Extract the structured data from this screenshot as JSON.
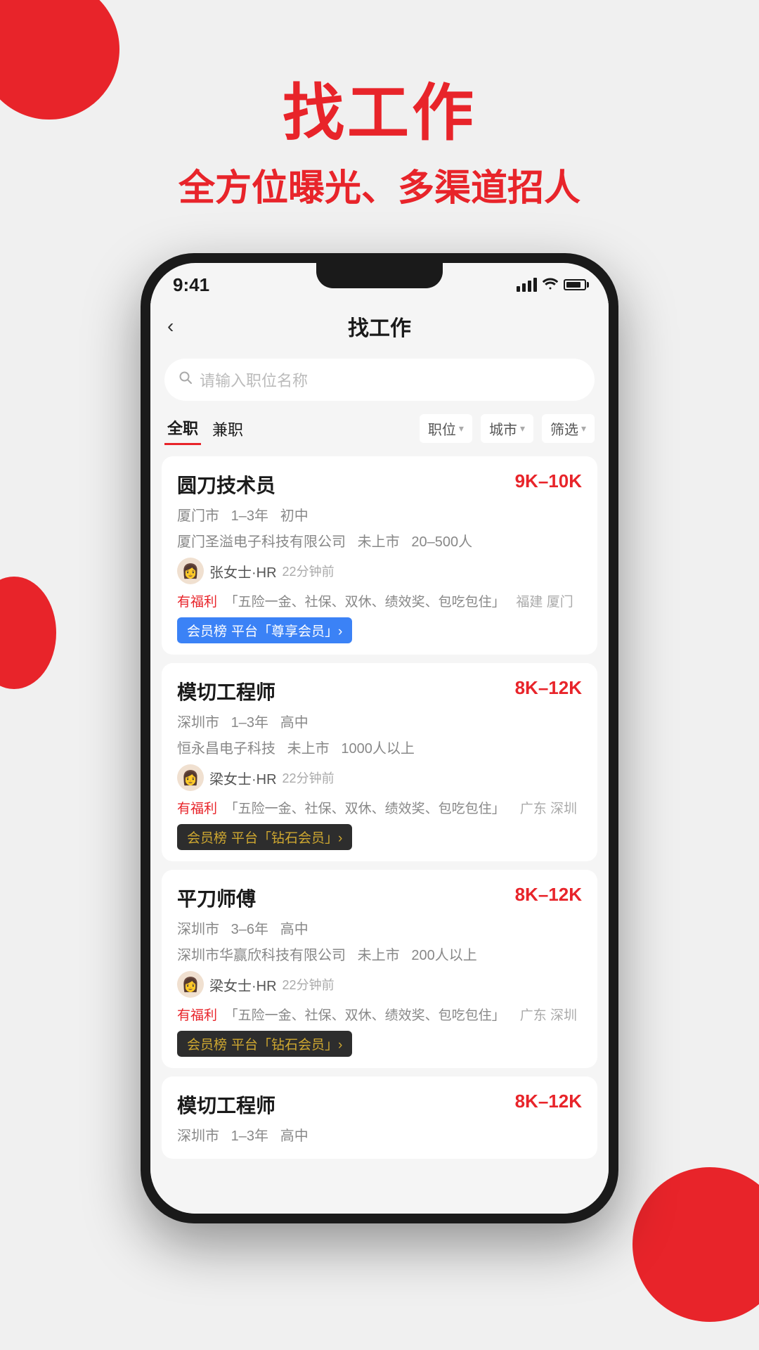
{
  "app": {
    "header_title": "找工作",
    "header_subtitle": "全方位曝光、多渠道招人"
  },
  "status_bar": {
    "time": "9:41"
  },
  "nav": {
    "back": "‹",
    "title": "找工作"
  },
  "search": {
    "placeholder": "请输入职位名称"
  },
  "tabs": [
    {
      "label": "全职",
      "active": true
    },
    {
      "label": "兼职",
      "active": false
    }
  ],
  "filters": [
    {
      "label": "职位"
    },
    {
      "label": "城市"
    },
    {
      "label": "筛选"
    }
  ],
  "jobs": [
    {
      "title": "圆刀技术员",
      "salary": "9K–10K",
      "tags": "厦门市  1–3年  初中",
      "company": "厦门圣溢电子科技有限公司  未上市  20–500人",
      "hr_name": "张女士·HR",
      "hr_time": "22分钟前",
      "benefits_label": "有福利",
      "benefits": "「五险一金、社保、双休、绩效奖、包吃包住」",
      "location": "福建 厦门",
      "badge_text": "平台「尊享会员」›",
      "badge_type": "blue",
      "badge_prefix": "会员榜"
    },
    {
      "title": "模切工程师",
      "salary": "8K–12K",
      "tags": "深圳市  1–3年  高中",
      "company": "恒永昌电子科技  未上市  1000人以上",
      "hr_name": "梁女士·HR",
      "hr_time": "22分钟前",
      "benefits_label": "有福利",
      "benefits": "「五险一金、社保、双休、绩效奖、包吃包住」",
      "location": "广东 深圳",
      "badge_text": "平台「钻石会员」›",
      "badge_type": "dark",
      "badge_prefix": "会员榜"
    },
    {
      "title": "平刀师傅",
      "salary": "8K–12K",
      "tags": "深圳市  3–6年  高中",
      "company": "深圳市华赢欣科技有限公司  未上市  200人以上",
      "hr_name": "梁女士·HR",
      "hr_time": "22分钟前",
      "benefits_label": "有福利",
      "benefits": "「五险一金、社保、双休、绩效奖、包吃包住」",
      "location": "广东 深圳",
      "badge_text": "平台「钻石会员」›",
      "badge_type": "dark",
      "badge_prefix": "会员榜"
    },
    {
      "title": "模切工程师",
      "salary": "8K–12K",
      "tags": "深圳市  1–3年  高中",
      "company": "",
      "hr_name": "",
      "hr_time": "",
      "benefits_label": "",
      "benefits": "",
      "location": "",
      "badge_text": "",
      "badge_type": "",
      "badge_prefix": ""
    }
  ]
}
